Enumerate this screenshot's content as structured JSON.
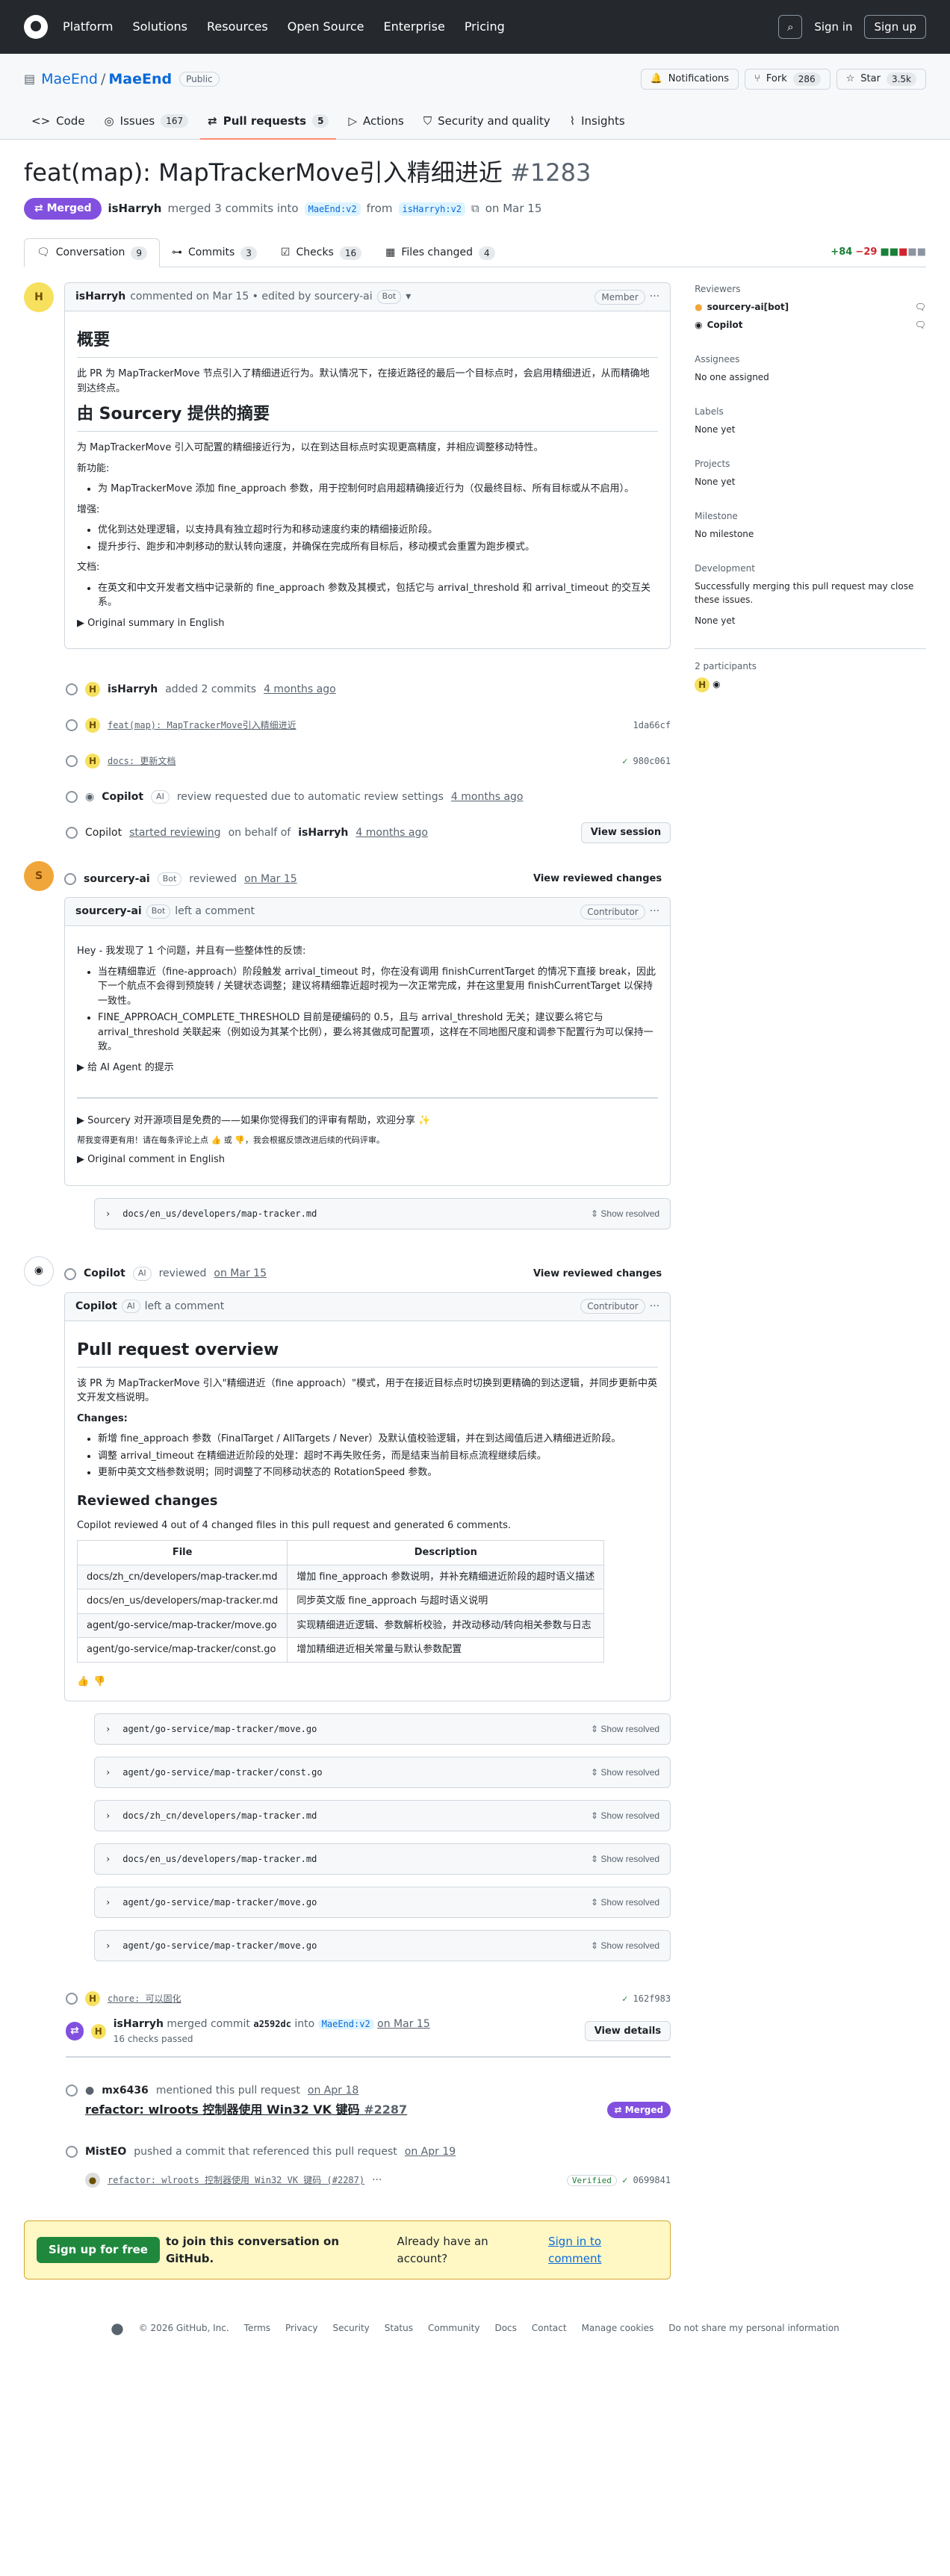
{
  "nav": {
    "items": [
      "Platform",
      "Solutions",
      "Resources",
      "Open Source",
      "Enterprise",
      "Pricing"
    ],
    "signin": "Sign in",
    "signup": "Sign up"
  },
  "repo": {
    "owner": "MaeEnd",
    "name": "MaeEnd",
    "visibility": "Public",
    "notifications": "Notifications",
    "fork": "Fork",
    "fork_count": "286",
    "star": "Star",
    "star_count": "3.5k"
  },
  "tabs": [
    {
      "label": "Code"
    },
    {
      "label": "Issues",
      "count": "167"
    },
    {
      "label": "Pull requests",
      "count": "5"
    },
    {
      "label": "Actions"
    },
    {
      "label": "Security and quality"
    },
    {
      "label": "Insights"
    }
  ],
  "pr": {
    "title": "feat(map): MapTrackerMove引入精细进近",
    "number": "#1283",
    "state": "Merged",
    "author": "isHarryh",
    "summary": "merged 3 commits into",
    "base": "MaeEnd:v2",
    "from": "from",
    "head": "isHarryh:v2",
    "date": "on Mar 15"
  },
  "prtabs": [
    {
      "label": "Conversation",
      "count": "9"
    },
    {
      "label": "Commits",
      "count": "3"
    },
    {
      "label": "Checks",
      "count": "16"
    },
    {
      "label": "Files changed",
      "count": "4"
    }
  ],
  "diffstat": {
    "add": "+84",
    "del": "−29"
  },
  "sidebar": {
    "reviewers_label": "Reviewers",
    "reviewers": [
      "sourcery-ai[bot]",
      "Copilot"
    ],
    "assignees_label": "Assignees",
    "assignees": "No one assigned",
    "labels_label": "Labels",
    "labels": "None yet",
    "projects_label": "Projects",
    "projects": "None yet",
    "milestone_label": "Milestone",
    "milestone": "No milestone",
    "development_label": "Development",
    "development_text": "Successfully merging this pull request may close these issues.",
    "development_none": "None yet",
    "participants": "2 participants"
  },
  "c1": {
    "author": "isHarryh",
    "text": "commented on Mar 15 • edited by sourcery-ai",
    "tag": "Bot",
    "role": "Member",
    "h_overview": "概要",
    "p1": "此 PR 为 MapTrackerMove 节点引入了精细进近行为。默认情况下，在接近路径的最后一个目标点时，会启用精细进近，从而精确地到达终点。",
    "h_sourcery": "由 Sourcery 提供的摘要",
    "p2": "为 MapTrackerMove 引入可配置的精细接近行为，以在到达目标点时实现更高精度，并相应调整移动特性。",
    "new_label": "新功能:",
    "new1": "为 MapTrackerMove 添加 fine_approach 参数，用于控制何时启用超精确接近行为（仅最终目标、所有目标或从不启用）。",
    "enh_label": "增强:",
    "enh1": "优化到达处理逻辑，以支持具有独立超时行为和移动速度约束的精细接近阶段。",
    "enh2": "提升步行、跑步和冲刺移动的默认转向速度，并确保在完成所有目标后，移动模式会重置为跑步模式。",
    "doc_label": "文档:",
    "doc1": "在英文和中文开发者文档中记录新的 fine_approach 参数及其模式，包括它与 arrival_threshold 和 arrival_timeout 的交互关系。",
    "orig": "▶ Original summary in English"
  },
  "events": {
    "added": "added 2 commits",
    "added_time": "4 months ago",
    "commit1": "feat(map): MapTrackerMove引入精细进近",
    "sha1": "1da66cf",
    "commit2": "docs: 更新文档",
    "sha2": "980c061",
    "copilot_req": "review requested due to automatic review settings",
    "req_time": "4 months ago",
    "copilot_start": "started reviewing",
    "behalf": "on behalf of",
    "start_time": "4 months ago",
    "view_session": "View session"
  },
  "rev1": {
    "author": "sourcery-ai",
    "tag": "Bot",
    "text": "reviewed",
    "date": "on Mar 15",
    "view": "View reviewed changes",
    "left": "left a comment",
    "role": "Contributor",
    "p": "Hey - 我发现了 1 个问题，并且有一些整体性的反馈:",
    "li1": "当在精细靠近（fine-approach）阶段触发 arrival_timeout 时，你在没有调用 finishCurrentTarget 的情况下直接 break，因此下一个航点不会得到预旋转 / 关键状态调整；建议将精细靠近超时视为一次正常完成，并在这里复用 finishCurrentTarget 以保持一致性。",
    "li2": "FINE_APPROACH_COMPLETE_THRESHOLD 目前是硬编码的 0.5，且与 arrival_threshold 无关；建议要么将它与 arrival_threshold 关联起来（例如设为其某个比例），要么将其做成可配置项，这样在不同地图尺度和调参下配置行为可以保持一致。",
    "ai": "▶ 给 AI Agent 的提示",
    "free": "▶ Sourcery 对开源项目是免费的——如果你觉得我们的评审有帮助，欢迎分享 ✨",
    "help": "帮我变得更有用！请在每条评论上点 👍 或 👎，我会根据反馈改进后续的代码评审。",
    "orig": "▶ Original comment in English",
    "file": "docs/en_us/developers/map-tracker.md",
    "show": "Show resolved"
  },
  "rev2": {
    "author": "Copilot",
    "tag": "AI",
    "text": "reviewed",
    "date": "on Mar 15",
    "view": "View reviewed changes",
    "left": "left a comment",
    "role": "Contributor",
    "h": "Pull request overview",
    "p1": "该 PR 为 MapTrackerMove 引入\"精细进近（fine approach）\"模式，用于在接近目标点时切换到更精确的到达逻辑，并同步更新中英文开发文档说明。",
    "changes": "Changes:",
    "c1": "新增 fine_approach 参数（FinalTarget / AllTargets / Never）及默认值校验逻辑，并在到达阈值后进入精细进近阶段。",
    "c2": "调整 arrival_timeout 在精细进近阶段的处理：超时不再失败任务，而是结束当前目标点流程继续后续。",
    "c3": "更新中英文文档参数说明；同时调整了不同移动状态的 RotationSpeed 参数。",
    "h3": "Reviewed changes",
    "p2": "Copilot reviewed 4 out of 4 changed files in this pull request and generated 6 comments.",
    "th": [
      "File",
      "Description"
    ],
    "rows": [
      [
        "docs/zh_cn/developers/map-tracker.md",
        "增加 fine_approach 参数说明，并补充精细进近阶段的超时语义描述"
      ],
      [
        "docs/en_us/developers/map-tracker.md",
        "同步英文版 fine_approach 与超时语义说明"
      ],
      [
        "agent/go-service/map-tracker/move.go",
        "实现精细进近逻辑、参数解析校验，并改动移动/转向相关参数与日志"
      ],
      [
        "agent/go-service/map-tracker/const.go",
        "增加精细进近相关常量与默认参数配置"
      ]
    ],
    "files": [
      "agent/go-service/map-tracker/move.go",
      "agent/go-service/map-tracker/const.go",
      "docs/zh_cn/developers/map-tracker.md",
      "docs/en_us/developers/map-tracker.md",
      "agent/go-service/map-tracker/move.go",
      "agent/go-service/map-tracker/move.go"
    ],
    "show": "Show resolved"
  },
  "end": {
    "commit3": "chore: 可以固化",
    "sha3": "162f983",
    "merged_user": "isHarryh",
    "merged_text": "merged commit",
    "merged_sha": "a2592dc",
    "into": "into",
    "base": "MaeEnd:v2",
    "date": "on Mar 15",
    "checks": "16 checks passed",
    "details": "View details",
    "mention_user": "mx6436",
    "mention_text": "mentioned this pull request",
    "mention_date": "on Apr 18",
    "ref_title": "refactor: wlroots 控制器使用 Win32 VK 键码",
    "ref_num": "#2287",
    "ref_state": "Merged",
    "push_user": "MistEO",
    "push_text": "pushed a commit that referenced this pull request",
    "push_date": "on Apr 19",
    "push_commit": "refactor: wlroots 控制器使用 Win32 VK 键码 (#2287)",
    "verified": "Verified",
    "push_sha": "0699841"
  },
  "signup": {
    "button": "Sign up for free",
    "text": "to join this conversation on GitHub.",
    "already": "Already have an account?",
    "signin": "Sign in to comment"
  },
  "footer": [
    "© 2026 GitHub, Inc.",
    "Terms",
    "Privacy",
    "Security",
    "Status",
    "Community",
    "Docs",
    "Contact",
    "Manage cookies",
    "Do not share my personal information"
  ]
}
